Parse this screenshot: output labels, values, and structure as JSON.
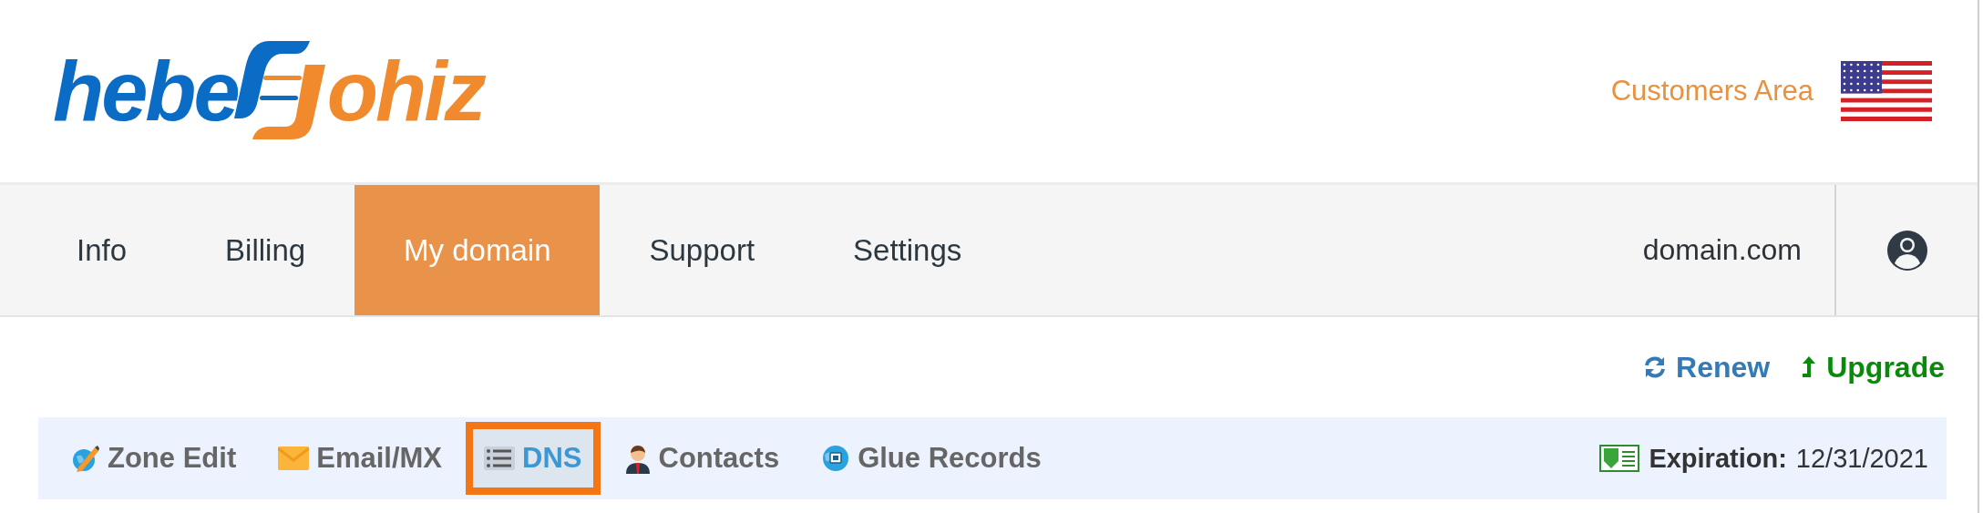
{
  "logo": {
    "left": "hebe",
    "right": "ohiz"
  },
  "header": {
    "customers_area": "Customers Area"
  },
  "nav": {
    "items": [
      {
        "label": "Info",
        "selected": false
      },
      {
        "label": "Billing",
        "selected": false
      },
      {
        "label": "My domain",
        "selected": true
      },
      {
        "label": "Support",
        "selected": false
      },
      {
        "label": "Settings",
        "selected": false
      }
    ],
    "domain": "domain.com"
  },
  "actions": [
    {
      "kind": "renew",
      "label": "Renew"
    },
    {
      "kind": "upgrade",
      "label": "Upgrade"
    }
  ],
  "subnav": {
    "items": [
      {
        "kind": "zone",
        "label": "Zone Edit",
        "selected": false
      },
      {
        "kind": "email",
        "label": "Email/MX",
        "selected": false
      },
      {
        "kind": "dns",
        "label": "DNS",
        "selected": true
      },
      {
        "kind": "contacts",
        "label": "Contacts",
        "selected": false
      },
      {
        "kind": "glue",
        "label": "Glue Records",
        "selected": false
      }
    ],
    "expiration": {
      "label": "Expiration:",
      "value": "12/31/2021"
    }
  }
}
